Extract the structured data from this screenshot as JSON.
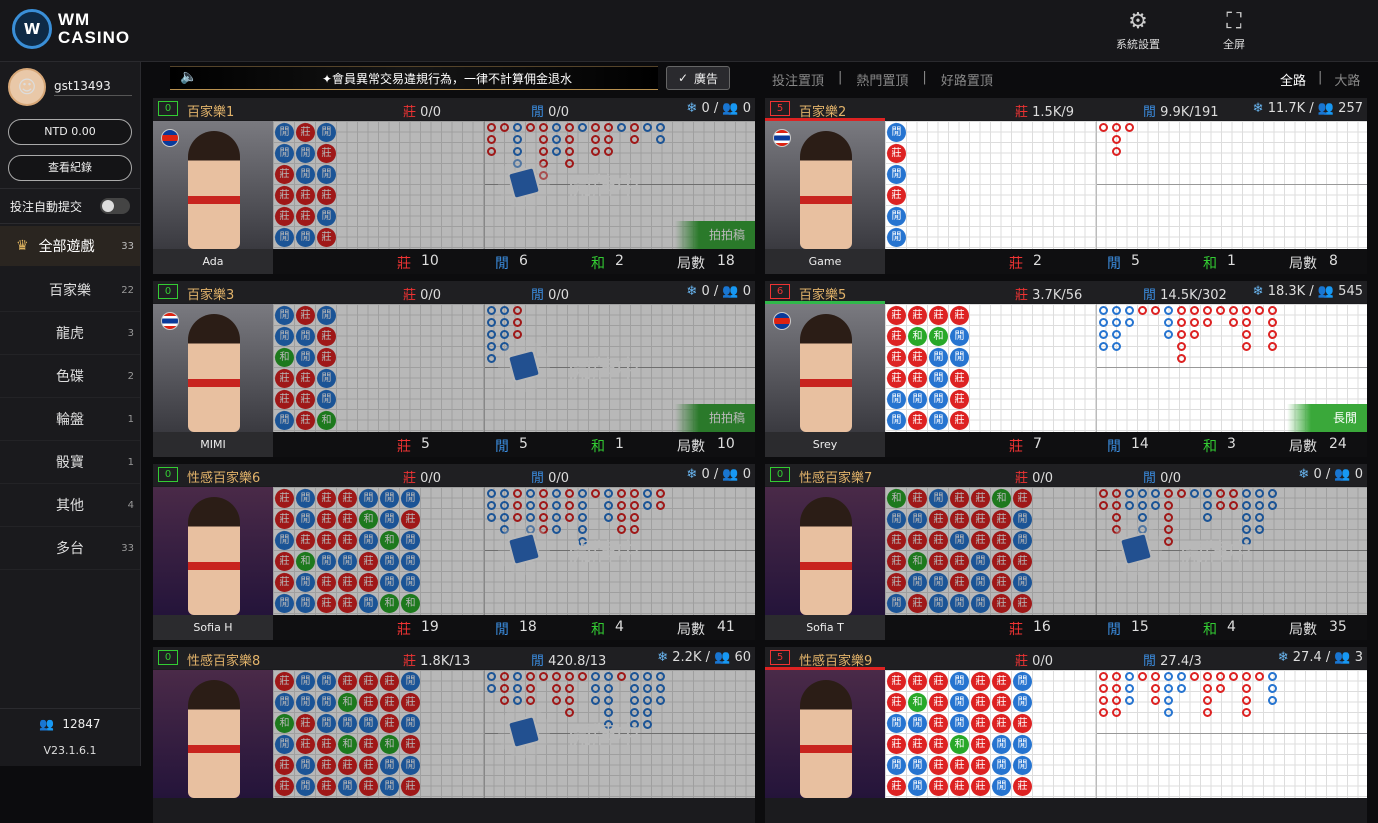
{
  "header": {
    "logo_mark": "W",
    "logo_line1": "WM",
    "logo_line2": "CASINO",
    "settings_label": "系統設置",
    "fullscreen_label": "全屏"
  },
  "user": {
    "name": "gst13493",
    "balance": "NTD 0.00",
    "history_label": "查看紀錄",
    "auto_submit_label": "投注自動提交"
  },
  "categories": {
    "all": {
      "label": "全部遊戲",
      "count": "33"
    },
    "items": [
      {
        "label": "百家樂",
        "count": "22"
      },
      {
        "label": "龍虎",
        "count": "3"
      },
      {
        "label": "色碟",
        "count": "2"
      },
      {
        "label": "輪盤",
        "count": "1"
      },
      {
        "label": "骰寶",
        "count": "1"
      },
      {
        "label": "其他",
        "count": "4"
      },
      {
        "label": "多台",
        "count": "33"
      }
    ]
  },
  "footer": {
    "online": "12847",
    "version": "V23.1.6.1"
  },
  "notice": {
    "text": "✦會員異常交易違規行為，一律不計算佣金退水",
    "ad_label": "廣告"
  },
  "filters": [
    "投注置頂",
    "|",
    "熱門置頂",
    "|",
    "好路置頂"
  ],
  "views": {
    "all": "全路",
    "sep": "|",
    "big": "大路"
  },
  "tables": [
    {
      "no": "0",
      "name": "百家樂1",
      "bk": "0/0",
      "pl": "0/0",
      "stake": "0",
      "users": "0",
      "dealer": "Ada",
      "flag": "kh",
      "state": "開牌中",
      "ribbon": "拍拍稿",
      "b": "10",
      "p": "6",
      "t": "2",
      "rounds": "18"
    },
    {
      "no": "5",
      "name": "百家樂2",
      "bk": "1.5K/9",
      "pl": "9.9K/191",
      "stake": "11.7K",
      "users": "257",
      "dealer": "Game",
      "flag": "th",
      "state": "",
      "ribbon": "",
      "b": "2",
      "p": "5",
      "t": "1",
      "rounds": "8"
    },
    {
      "no": "0",
      "name": "百家樂3",
      "bk": "0/0",
      "pl": "0/0",
      "stake": "0",
      "users": "0",
      "dealer": "MIMI",
      "flag": "th",
      "state": "開牌中",
      "ribbon": "拍拍稿",
      "b": "5",
      "p": "5",
      "t": "1",
      "rounds": "10"
    },
    {
      "no": "6",
      "name": "百家樂5",
      "bk": "3.7K/56",
      "pl": "14.5K/302",
      "stake": "18.3K",
      "users": "545",
      "dealer": "Srey",
      "flag": "kh",
      "state": "",
      "ribbon": "長閒",
      "b": "7",
      "p": "14",
      "t": "3",
      "rounds": "24"
    },
    {
      "no": "0",
      "name": "性感百家樂6",
      "bk": "0/0",
      "pl": "0/0",
      "stake": "0",
      "users": "0",
      "dealer": "Sofia H",
      "flag": "",
      "state": "開牌中",
      "ribbon": "",
      "b": "19",
      "p": "18",
      "t": "4",
      "rounds": "41"
    },
    {
      "no": "0",
      "name": "性感百家樂7",
      "bk": "0/0",
      "pl": "0/0",
      "stake": "0",
      "users": "0",
      "dealer": "Sofia T",
      "flag": "",
      "state": "開牌中",
      "ribbon": "",
      "b": "16",
      "p": "15",
      "t": "4",
      "rounds": "35"
    },
    {
      "no": "0",
      "name": "性感百家樂8",
      "bk": "1.8K/13",
      "pl": "420.8/13",
      "stake": "2.2K",
      "users": "60",
      "dealer": "",
      "flag": "",
      "state": "開牌中",
      "ribbon": "",
      "b": "",
      "p": "",
      "t": "",
      "rounds": ""
    },
    {
      "no": "5",
      "name": "性感百家樂9",
      "bk": "0/0",
      "pl": "27.4/3",
      "stake": "27.4",
      "users": "3",
      "dealer": "",
      "flag": "",
      "state": "",
      "ribbon": "",
      "b": "",
      "p": "",
      "t": "",
      "rounds": ""
    }
  ],
  "labels": {
    "banker": "莊",
    "player": "閒",
    "tie": "和",
    "rounds": "局數",
    "sep": "/"
  },
  "colors": {
    "banker": "#e33333",
    "player": "#3b8de0",
    "tie": "#33cc33",
    "accent": "#e2b36a"
  }
}
